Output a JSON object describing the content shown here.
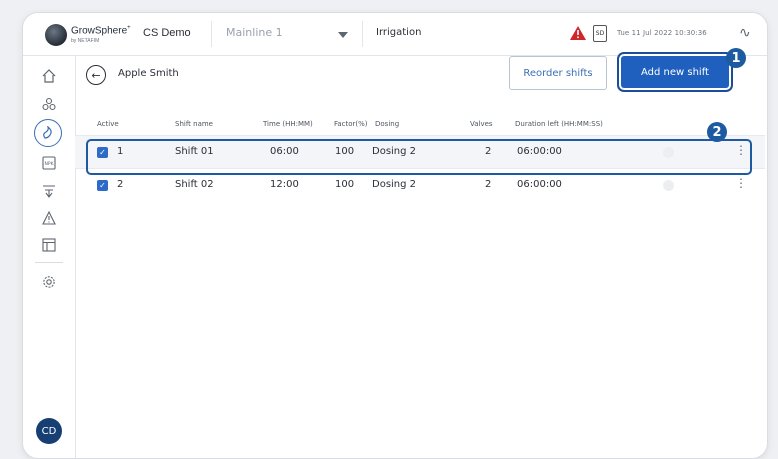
{
  "topbar": {
    "brand": "GrowSphere",
    "brand_sub": "by NETAFIM",
    "farm": "CS Demo",
    "mainline": "Mainline 1",
    "section": "Irrigation",
    "datetime": "Tue 11 Jul 2022  10:30:36",
    "sd_label": "SD"
  },
  "sidebar": {
    "icons": [
      "home-icon",
      "plant-icon",
      "irrigation-icon",
      "npk-icon",
      "filter-icon",
      "alert-icon",
      "table-icon",
      "settings-icon"
    ],
    "avatar": "CD"
  },
  "header": {
    "person": "Apple Smith",
    "reorder_label": "Reorder shifts",
    "add_label": "Add new shift"
  },
  "table": {
    "columns": [
      "Active",
      "Shift name",
      "Time (HH:MM)",
      "Factor(%)",
      "Dosing",
      "Valves",
      "Duration left (HH:MM:SS)"
    ],
    "rows": [
      {
        "num": "1",
        "name": "Shift 01",
        "time": "06:00",
        "factor": "100",
        "dosing": "Dosing 2",
        "valves": "2",
        "duration": "06:00:00"
      },
      {
        "num": "2",
        "name": "Shift 02",
        "time": "12:00",
        "factor": "100",
        "dosing": "Dosing 2",
        "valves": "2",
        "duration": "06:00:00"
      }
    ]
  },
  "callouts": [
    "1",
    "2"
  ],
  "colors": {
    "accent": "#1f5fbd",
    "badge": "#1d5aa0",
    "alert": "#d0262b"
  }
}
